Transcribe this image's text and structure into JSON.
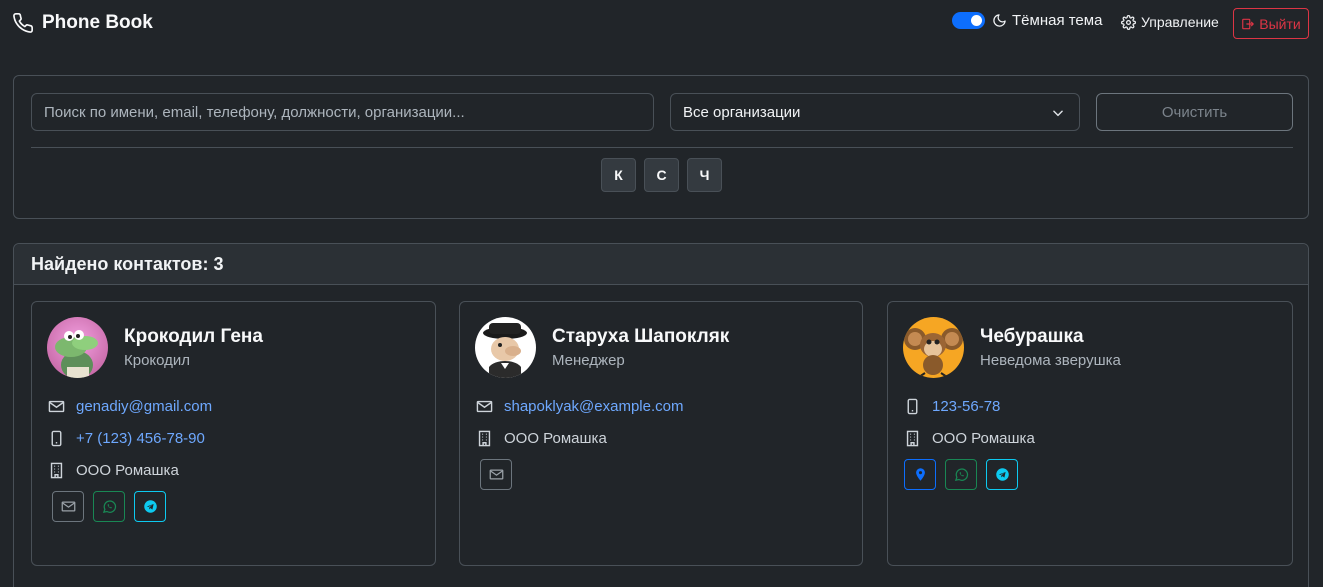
{
  "navbar": {
    "brand": "Phone Book",
    "theme_label": "Тёмная тема",
    "theme_dark": true,
    "manage_label": "Управление",
    "logout_label": "Выйти"
  },
  "search": {
    "placeholder": "Поиск по имени, email, телефону, должности, организации...",
    "value": "",
    "organization_selected": "Все организации",
    "clear_label": "Очистить",
    "letters": [
      "К",
      "С",
      "Ч"
    ]
  },
  "results": {
    "title": "Найдено контактов: 3",
    "contacts": [
      {
        "name": "Крокодил Гена",
        "position": "Крокодил",
        "email": "genadiy@gmail.com",
        "phone": "+7 (123) 456-78-90",
        "organization": "ООО Ромашка",
        "actions": [
          "mail-icon",
          "whatsapp-icon",
          "telegram-icon"
        ]
      },
      {
        "name": "Старуха Шапокляк",
        "position": "Менеджер",
        "email": "shapoklyak@example.com",
        "organization": "ООО Ромашка",
        "actions": [
          "mail-icon"
        ]
      },
      {
        "name": "Чебурашка",
        "position": "Неведома зверушка",
        "phone": "123-56-78",
        "organization": "ООО Ромашка",
        "actions": [
          "map-pin-icon",
          "whatsapp-icon",
          "telegram-icon"
        ]
      }
    ]
  },
  "colors": {
    "background": "#212529",
    "accent": "#0d6efd",
    "link": "#6ea8fe",
    "danger": "#dc3545",
    "success": "#198754",
    "info": "#0dcaf0"
  }
}
